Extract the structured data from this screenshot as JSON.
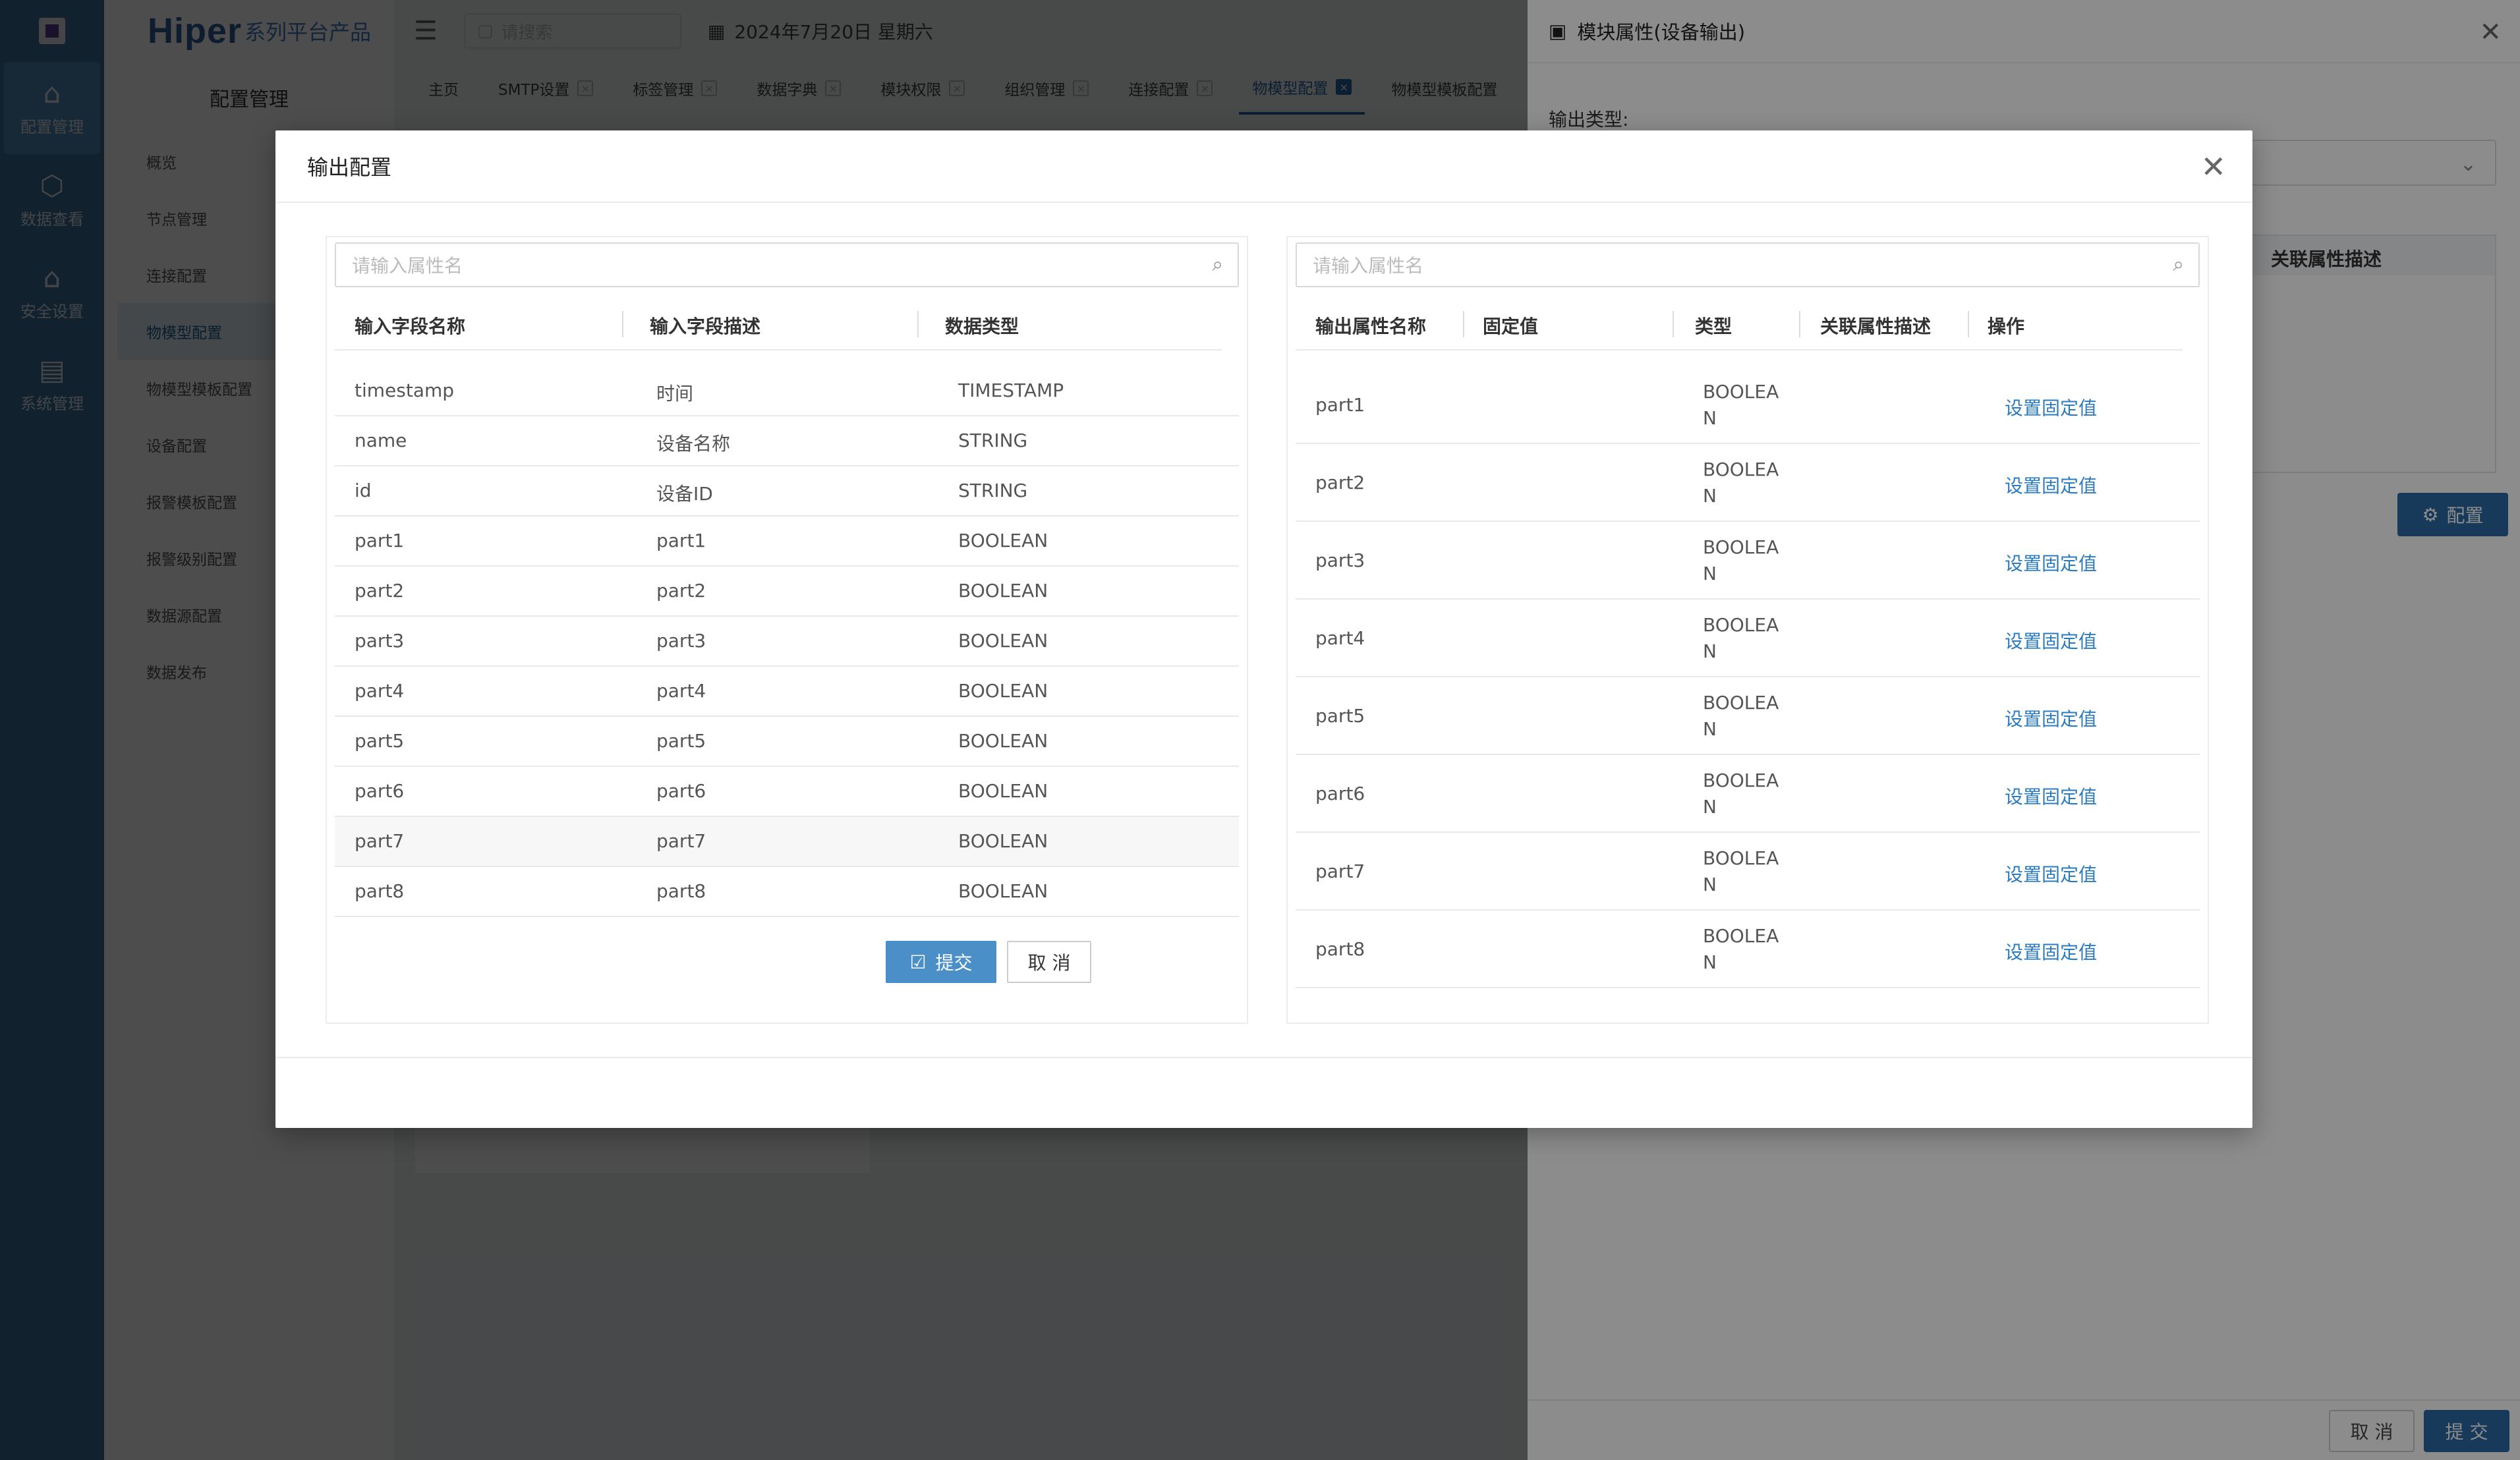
{
  "app": {
    "brand_main": "Hiper",
    "brand_sub": "系列平台产品",
    "rail": [
      {
        "label": "配置管理",
        "icon": "building-icon"
      },
      {
        "label": "数据查看",
        "icon": "cube-icon"
      },
      {
        "label": "安全设置",
        "icon": "lock-home-icon"
      },
      {
        "label": "系统管理",
        "icon": "settings-panel-icon"
      }
    ],
    "side_title": "配置管理",
    "menu": [
      "概览",
      "节点管理",
      "连接配置",
      "物模型配置",
      "物模型模板配置",
      "设备配置",
      "报警模板配置",
      "报警级别配置",
      "数据源配置",
      "数据发布"
    ],
    "search_placeholder": "请搜索",
    "date": "2024年7月20日 星期六",
    "tabs": [
      "主页",
      "SMTP设置",
      "标签管理",
      "数据字典",
      "模块权限",
      "组织管理",
      "连接配置",
      "物模型配置",
      "物模型模板配置"
    ]
  },
  "drawer": {
    "title": "模块属性(设备输出)",
    "output_type_label": "输出类型:",
    "table_header": "关联属性描述",
    "config_button": "配置",
    "cancel": "取 消",
    "submit": "提 交"
  },
  "modal": {
    "title": "输出配置",
    "left": {
      "search_placeholder": "请输入属性名",
      "columns": [
        "输入字段名称",
        "输入字段描述",
        "数据类型"
      ],
      "rows": [
        {
          "name": "timestamp",
          "desc": "时间",
          "type": "TIMESTAMP"
        },
        {
          "name": "name",
          "desc": "设备名称",
          "type": "STRING"
        },
        {
          "name": "id",
          "desc": "设备ID",
          "type": "STRING"
        },
        {
          "name": "part1",
          "desc": "part1",
          "type": "BOOLEAN"
        },
        {
          "name": "part2",
          "desc": "part2",
          "type": "BOOLEAN"
        },
        {
          "name": "part3",
          "desc": "part3",
          "type": "BOOLEAN"
        },
        {
          "name": "part4",
          "desc": "part4",
          "type": "BOOLEAN"
        },
        {
          "name": "part5",
          "desc": "part5",
          "type": "BOOLEAN"
        },
        {
          "name": "part6",
          "desc": "part6",
          "type": "BOOLEAN"
        },
        {
          "name": "part7",
          "desc": "part7",
          "type": "BOOLEAN"
        },
        {
          "name": "part8",
          "desc": "part8",
          "type": "BOOLEAN"
        }
      ]
    },
    "right": {
      "search_placeholder": "请输入属性名",
      "columns": [
        "输出属性名称",
        "固定值",
        "类型",
        "关联属性描述",
        "操作"
      ],
      "rows": [
        {
          "name": "part1",
          "type_line1": "BOOLEA",
          "type_line2": "N",
          "action": "设置固定值"
        },
        {
          "name": "part2",
          "type_line1": "BOOLEA",
          "type_line2": "N",
          "action": "设置固定值"
        },
        {
          "name": "part3",
          "type_line1": "BOOLEA",
          "type_line2": "N",
          "action": "设置固定值"
        },
        {
          "name": "part4",
          "type_line1": "BOOLEA",
          "type_line2": "N",
          "action": "设置固定值"
        },
        {
          "name": "part5",
          "type_line1": "BOOLEA",
          "type_line2": "N",
          "action": "设置固定值"
        },
        {
          "name": "part6",
          "type_line1": "BOOLEA",
          "type_line2": "N",
          "action": "设置固定值"
        },
        {
          "name": "part7",
          "type_line1": "BOOLEA",
          "type_line2": "N",
          "action": "设置固定值"
        },
        {
          "name": "part8",
          "type_line1": "BOOLEA",
          "type_line2": "N",
          "action": "设置固定值"
        }
      ]
    },
    "submit": "提交",
    "cancel": "取 消"
  }
}
